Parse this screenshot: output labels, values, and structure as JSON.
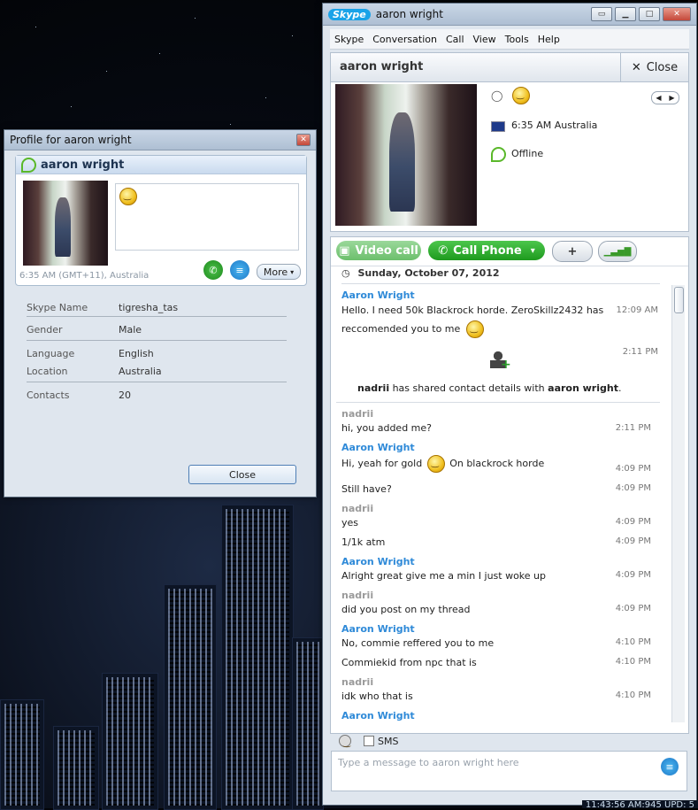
{
  "profile_window": {
    "title": "Profile for aaron wright",
    "card_name": "aaron wright",
    "local_time": "6:35 AM (GMT+11), Australia",
    "more_label": "More",
    "fields": [
      {
        "key": "Skype Name",
        "value": "tigresha_tas"
      },
      {
        "key": "Gender",
        "value": "Male"
      },
      {
        "key": "Language",
        "value": "English"
      },
      {
        "key": "Location",
        "value": "Australia"
      },
      {
        "key": "Contacts",
        "value": "20"
      }
    ],
    "close_label": "Close"
  },
  "skype_window": {
    "logo": "Skype",
    "title": "aaron wright",
    "menu": [
      "Skype",
      "Conversation",
      "Call",
      "View",
      "Tools",
      "Help"
    ],
    "contact_name": "aaron wright",
    "close_label": "Close",
    "time_location": "6:35 AM Australia",
    "status": "Offline",
    "video_call_label": "Video call",
    "call_phone_label": "Call Phone",
    "date_header": "Sunday, October 07, 2012",
    "shared_contact": {
      "who": "nadrii",
      "text": " has shared contact details with ",
      "target": "aaron wright",
      "end": ".",
      "time": "2:11 PM"
    },
    "messages": [
      {
        "sender": "Aaron Wright",
        "lines": [
          {
            "text": "Hello. I need 50k Blackrock horde. ZeroSkillz2432 has",
            "time": "12:09 AM"
          },
          {
            "text": "reccomended you to me",
            "time": ""
          }
        ]
      },
      {
        "sender": "nadrii",
        "lines": [
          {
            "text": "hi, you added me?",
            "time": "2:11 PM"
          }
        ]
      },
      {
        "sender": "Aaron Wright",
        "lines": [
          {
            "text": "Hi, yeah for gold",
            "text2": "On blackrock horde",
            "time": "4:09 PM"
          },
          {
            "text": "Still have?",
            "time": "4:09 PM"
          }
        ]
      },
      {
        "sender": "nadrii",
        "lines": [
          {
            "text": "yes",
            "time": "4:09 PM"
          },
          {
            "text": "1/1k atm",
            "time": "4:09 PM"
          }
        ]
      },
      {
        "sender": "Aaron Wright",
        "lines": [
          {
            "text": "Alright great give me a min I just woke up",
            "time": "4:09 PM"
          }
        ]
      },
      {
        "sender": "nadrii",
        "lines": [
          {
            "text": "did you post on my thread",
            "time": "4:09 PM"
          }
        ]
      },
      {
        "sender": "Aaron Wright",
        "lines": [
          {
            "text": "No, commie reffered you to me",
            "time": "4:10 PM"
          },
          {
            "text": "Commiekid from npc that is",
            "time": "4:10 PM"
          }
        ]
      },
      {
        "sender": "nadrii",
        "lines": [
          {
            "text": "idk who that is",
            "time": "4:10 PM"
          }
        ]
      },
      {
        "sender": "Aaron Wright",
        "lines": []
      }
    ],
    "sms_label": "SMS",
    "input_placeholder": "Type a message to aaron wright here"
  },
  "taskbar": {
    "clock": "11:43:56 AM:945 UPD: 5"
  }
}
